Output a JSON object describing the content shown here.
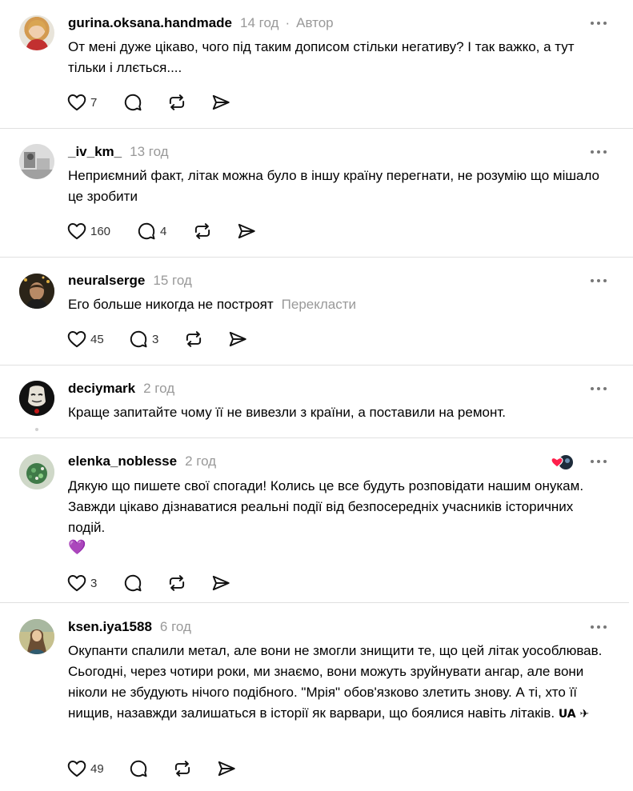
{
  "comments": [
    {
      "username": "gurina.oksana.handmade",
      "time": "14 год",
      "separator": "·",
      "author_label": "Автор",
      "text": "От мені дуже цікаво, чого під таким дописом стільки негативу? І так важко, а тут тільки і ллється....",
      "likes": "7",
      "replies": ""
    },
    {
      "username": "_iv_km_",
      "time": "13 год",
      "text": "Неприємний факт, літак можна було в іншу країну перегнати, не розумію що мішало це зробити",
      "likes": "160",
      "replies": "4"
    },
    {
      "username": "neuralserge",
      "time": "15 год",
      "text": "Его больше никогда не построят",
      "translate_label": "Перекласти",
      "likes": "45",
      "replies": "3"
    },
    {
      "username": "deciymark",
      "time": "2 год",
      "text": "Краще запитайте чому її не вивезли з країни, а поставили на ремонт."
    },
    {
      "username": "elenka_noblesse",
      "time": "2 год",
      "text": "Дякую що пишете свої спогади! Колись це все будуть розповідати нашим онукам. Завжди цікаво дізнаватися реальні події від безпосередніх учасників історичних подій.",
      "emoji": "💜",
      "likes": "3",
      "replies": ""
    },
    {
      "username": "ksen.iya1588",
      "time": "6 год",
      "text": "Окупанти спалили метал, але вони не змогли знищити те, що цей літак уособлював. Сьогодні, через чотири роки, ми знаємо, вони можуть зруйнувати ангар, але вони ніколи не збудують нічого подібного. \"Мрія\" обов'язково злетить знову. А ті, хто її нищив, назавжди залишаться в історії як варвари, що боялися навіть літаків.",
      "text_suffix": "UA ✈",
      "likes": "49",
      "replies": ""
    }
  ],
  "icons": {
    "like": "heart-icon",
    "reply": "comment-icon",
    "repost": "repost-icon",
    "share": "send-icon",
    "more": "more-options-icon"
  },
  "colors": {
    "text": "#000000",
    "muted": "#999999",
    "divider": "#e0e0e0",
    "icon": "#111111"
  }
}
